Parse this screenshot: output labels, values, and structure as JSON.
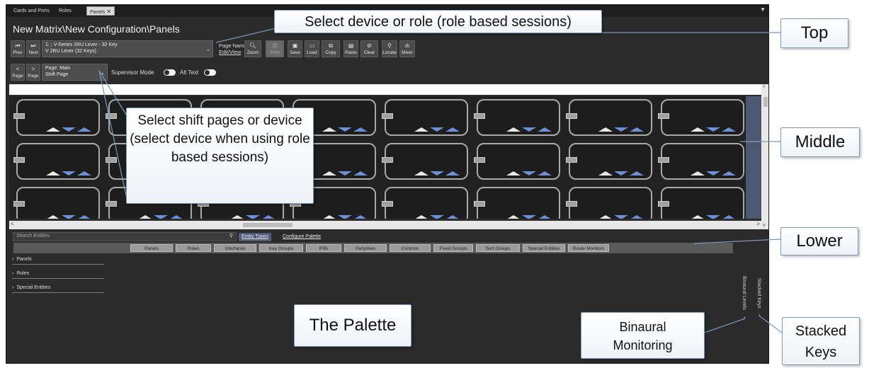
{
  "tabs": [
    {
      "label": "Cards and Ports"
    },
    {
      "label": "Roles"
    },
    {
      "label": "Panels",
      "close": "✕"
    }
  ],
  "tab_menu": "▼",
  "title": "New Matrix\\New Configuration\\Panels",
  "toolbar": {
    "prev": {
      "icon": "⏮",
      "label": "Prev"
    },
    "next": {
      "icon": "⏭",
      "label": "Next"
    },
    "device_select": {
      "line1": "1: ; V-Series 2RU Lever - 32 Key",
      "line2": "V 2RU Lever (32 Keys)"
    },
    "page_names": {
      "line1": "Page Names",
      "line2": "Edit/View"
    },
    "zoom": "Zoom",
    "print": "Print",
    "save": "Save",
    "load": "Load",
    "copy": "Copy",
    "paste": "Paste",
    "clear": "Clear",
    "locate": "Locate",
    "mixer": "Mixer"
  },
  "row2": {
    "page_prev": {
      "icon": "<",
      "label": "Page"
    },
    "page_next": {
      "icon": ">",
      "label": "Page"
    },
    "shift_select": {
      "line1": "Page: Main",
      "line2": "Shift Page"
    },
    "supervisor": "Supervisor Mode",
    "alt_text": "Alt Text"
  },
  "lower": {
    "search_placeholder": "Search Entities",
    "entity_types": "Entity Types",
    "configure_palette": "Configure Palette",
    "filters": [
      "Panels",
      "Roles",
      "Interfaces",
      "Key Groups",
      "IFBs",
      "Partylines",
      "Controls",
      "Fixed Groups",
      "Sort Groups",
      "Special Entities",
      "Route Monitors"
    ],
    "tree": [
      "Panels",
      "Roles",
      "Special Entities"
    ],
    "binaural_levels": "Binaural Levels",
    "stacked_keys": "Stacked Keys"
  },
  "callouts": {
    "select_device": "Select device or role (role based sessions)",
    "shift_pages": "Select shift pages or device (select device when using role based sessions)",
    "top": "Top",
    "middle": "Middle",
    "lower": "Lower",
    "palette": "The Palette",
    "binaural": "Binaural Monitoring",
    "stacked": "Stacked Keys"
  },
  "colors": {
    "panel_blue": "#6d8fd6",
    "active_tab": "#4f5b77"
  }
}
